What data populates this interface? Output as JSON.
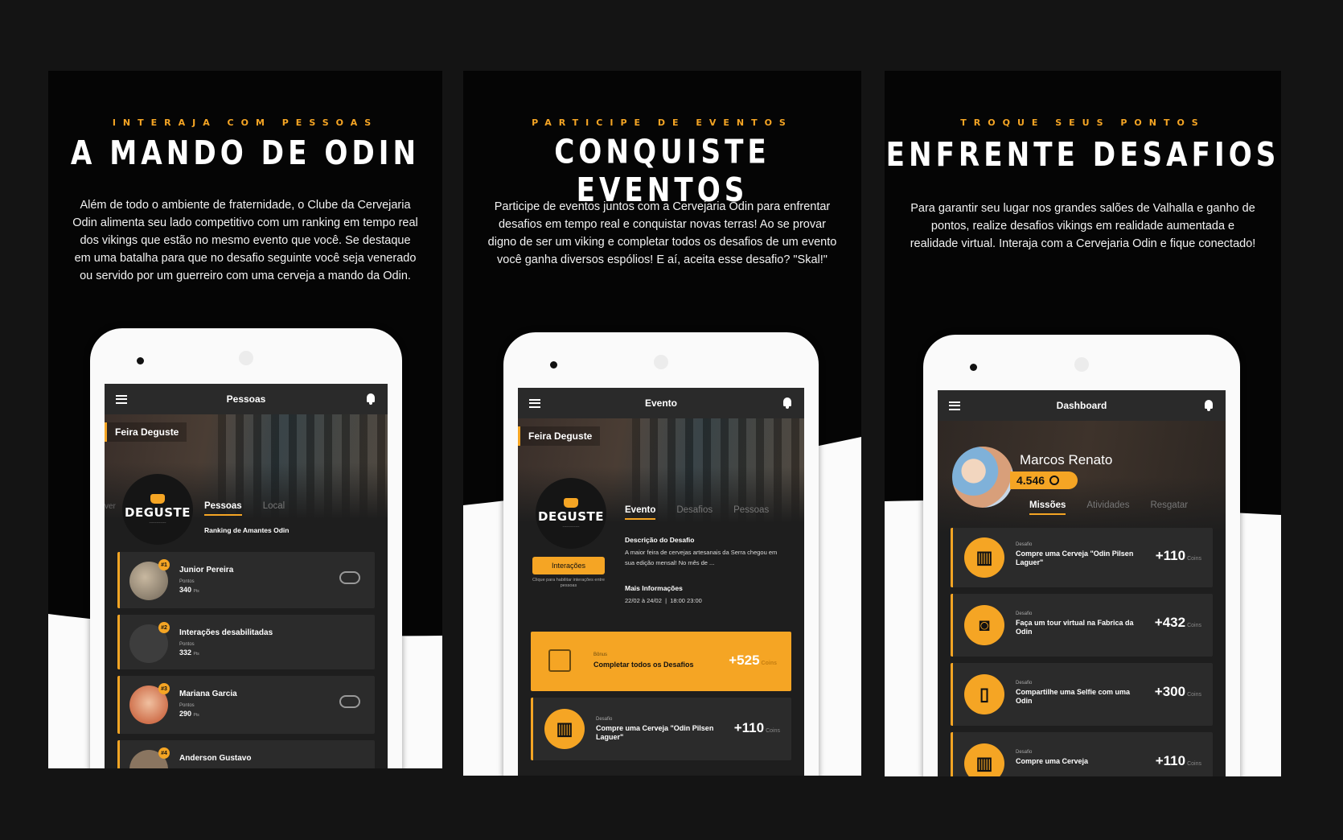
{
  "brand_color": "#f5a524",
  "panels": [
    {
      "kicker": "INTERAJA COM PESSOAS",
      "title": "A MANDO DE ODIN",
      "description": "Além de todo o ambiente  de fraternidade, o Clube da Cervejaria Odin alimenta seu lado competitivo com um ranking em tempo real dos vikings que estão no mesmo evento que você. Se destaque em uma batalha para que no desafio seguinte você seja venerado ou servido por um guerreiro com uma cerveja a mando da Odin.",
      "screen": {
        "appbar_title": "Pessoas",
        "event_name": "Feira Deguste",
        "logo_text": "DEGUSTE",
        "left_tab_fragment": "ver",
        "tabs": [
          "Pessoas",
          "Local"
        ],
        "section_title": "Ranking de Amantes Odin",
        "people": [
          {
            "rank": "#1",
            "name": "Junior Pereira",
            "label": "Pontos",
            "points": "340",
            "unit": "Pts"
          },
          {
            "rank": "#2",
            "name": "Interações desabilitadas",
            "label": "Pontos",
            "points": "332",
            "unit": "Pts"
          },
          {
            "rank": "#3",
            "name": "Mariana Garcia",
            "label": "Pontos",
            "points": "290",
            "unit": "Pts"
          },
          {
            "rank": "#4",
            "name": "Anderson Gustavo",
            "label": "",
            "points": "",
            "unit": ""
          }
        ]
      }
    },
    {
      "kicker": "PARTICIPE DE EVENTOS",
      "title": "CONQUISTE EVENTOS",
      "description": "Participe de eventos juntos com a Cervejaria Odin para enfrentar desafios em tempo real e conquistar novas terras! Ao se provar digno de ser um viking e completar todos os desafios de um evento você ganha diversos espólios! E aí, aceita esse desafio? \"Skal!\"",
      "screen": {
        "appbar_title": "Evento",
        "event_name": "Feira Deguste",
        "logo_text": "DEGUSTE",
        "tabs": [
          "Evento",
          "Desafios",
          "Pessoas"
        ],
        "button_label": "Interações",
        "button_hint": "Clique para habilitar interações entre pessoas",
        "desc_heading": "Descrição do Desafio",
        "desc_text": "A maior feira de cervejas artesanais da Serra chegou em sua edição mensal! No mês de ...",
        "info_heading": "Mais Informações",
        "info_date": "22/02 à 24/02",
        "info_sep": "|",
        "info_time": "18:00 23:00",
        "challenges": [
          {
            "label": "Bônus",
            "text": "Completar todos os Desafios",
            "value": "+525",
            "unit": "Coins"
          },
          {
            "label": "Desafio",
            "text": "Compre uma Cerveja \"Odin Pilsen Laguer\"",
            "value": "+110",
            "unit": "Coins"
          }
        ]
      }
    },
    {
      "kicker": "TROQUE SEUS PONTOS",
      "title": "ENFRENTE DESAFIOS",
      "description": "Para garantir seu lugar nos grandes salões de Valhalla e ganho de pontos, realize desafios vikings em realidade aumentada e realidade virtual. Interaja com a Cervejaria Odin e fique conectado!",
      "screen": {
        "appbar_title": "Dashboard",
        "user_name": "Marcos Renato",
        "user_points": "4.546",
        "tabs": [
          "Missões",
          "Atividades",
          "Resgatar"
        ],
        "missions": [
          {
            "label": "Desafio",
            "text": "Compre uma Cerveja \"Odin Pilsen Laguer\"",
            "value": "+110",
            "unit": "Coins"
          },
          {
            "label": "Desafio",
            "text": "Faça um tour virtual na Fabrica da Odin",
            "value": "+432",
            "unit": "Coins"
          },
          {
            "label": "Desafio",
            "text": "Compartilhe uma Selfie com uma Odin",
            "value": "+300",
            "unit": "Coins"
          },
          {
            "label": "Desafio",
            "text": "Compre uma Cerveja",
            "value": "+110",
            "unit": "Coins"
          }
        ]
      }
    }
  ]
}
